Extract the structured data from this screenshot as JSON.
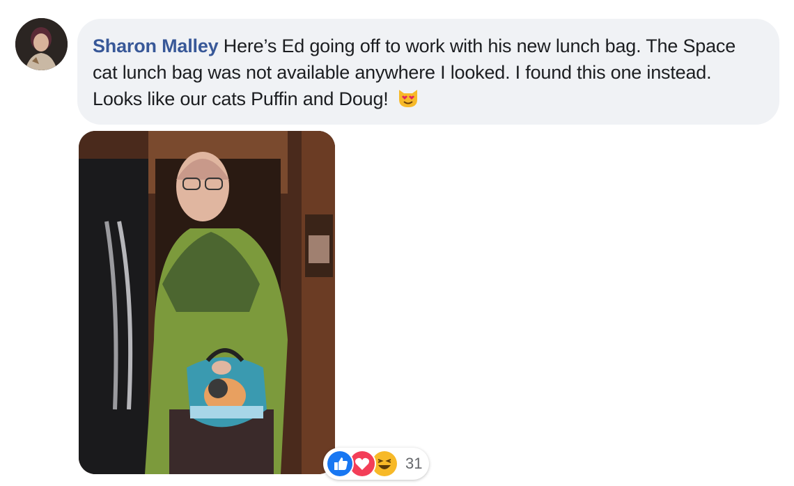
{
  "comment": {
    "author": "Sharon Malley",
    "text": "Here’s Ed going off to work with his new lunch bag. The Space cat lunch bag was not available anywhere I looked. I found this one instead. Looks like our cats Puffin and Doug!",
    "emoji": "smiling-cat-heart-eyes-icon"
  },
  "reactions": {
    "types": [
      "like",
      "love",
      "haha"
    ],
    "count": "31",
    "colors": {
      "like": "#1877f2",
      "love": "#f33e58",
      "haha": "#f7b928"
    }
  },
  "colors": {
    "author": "#385898",
    "bubble": "#f0f2f5",
    "text": "#1c1e21"
  }
}
